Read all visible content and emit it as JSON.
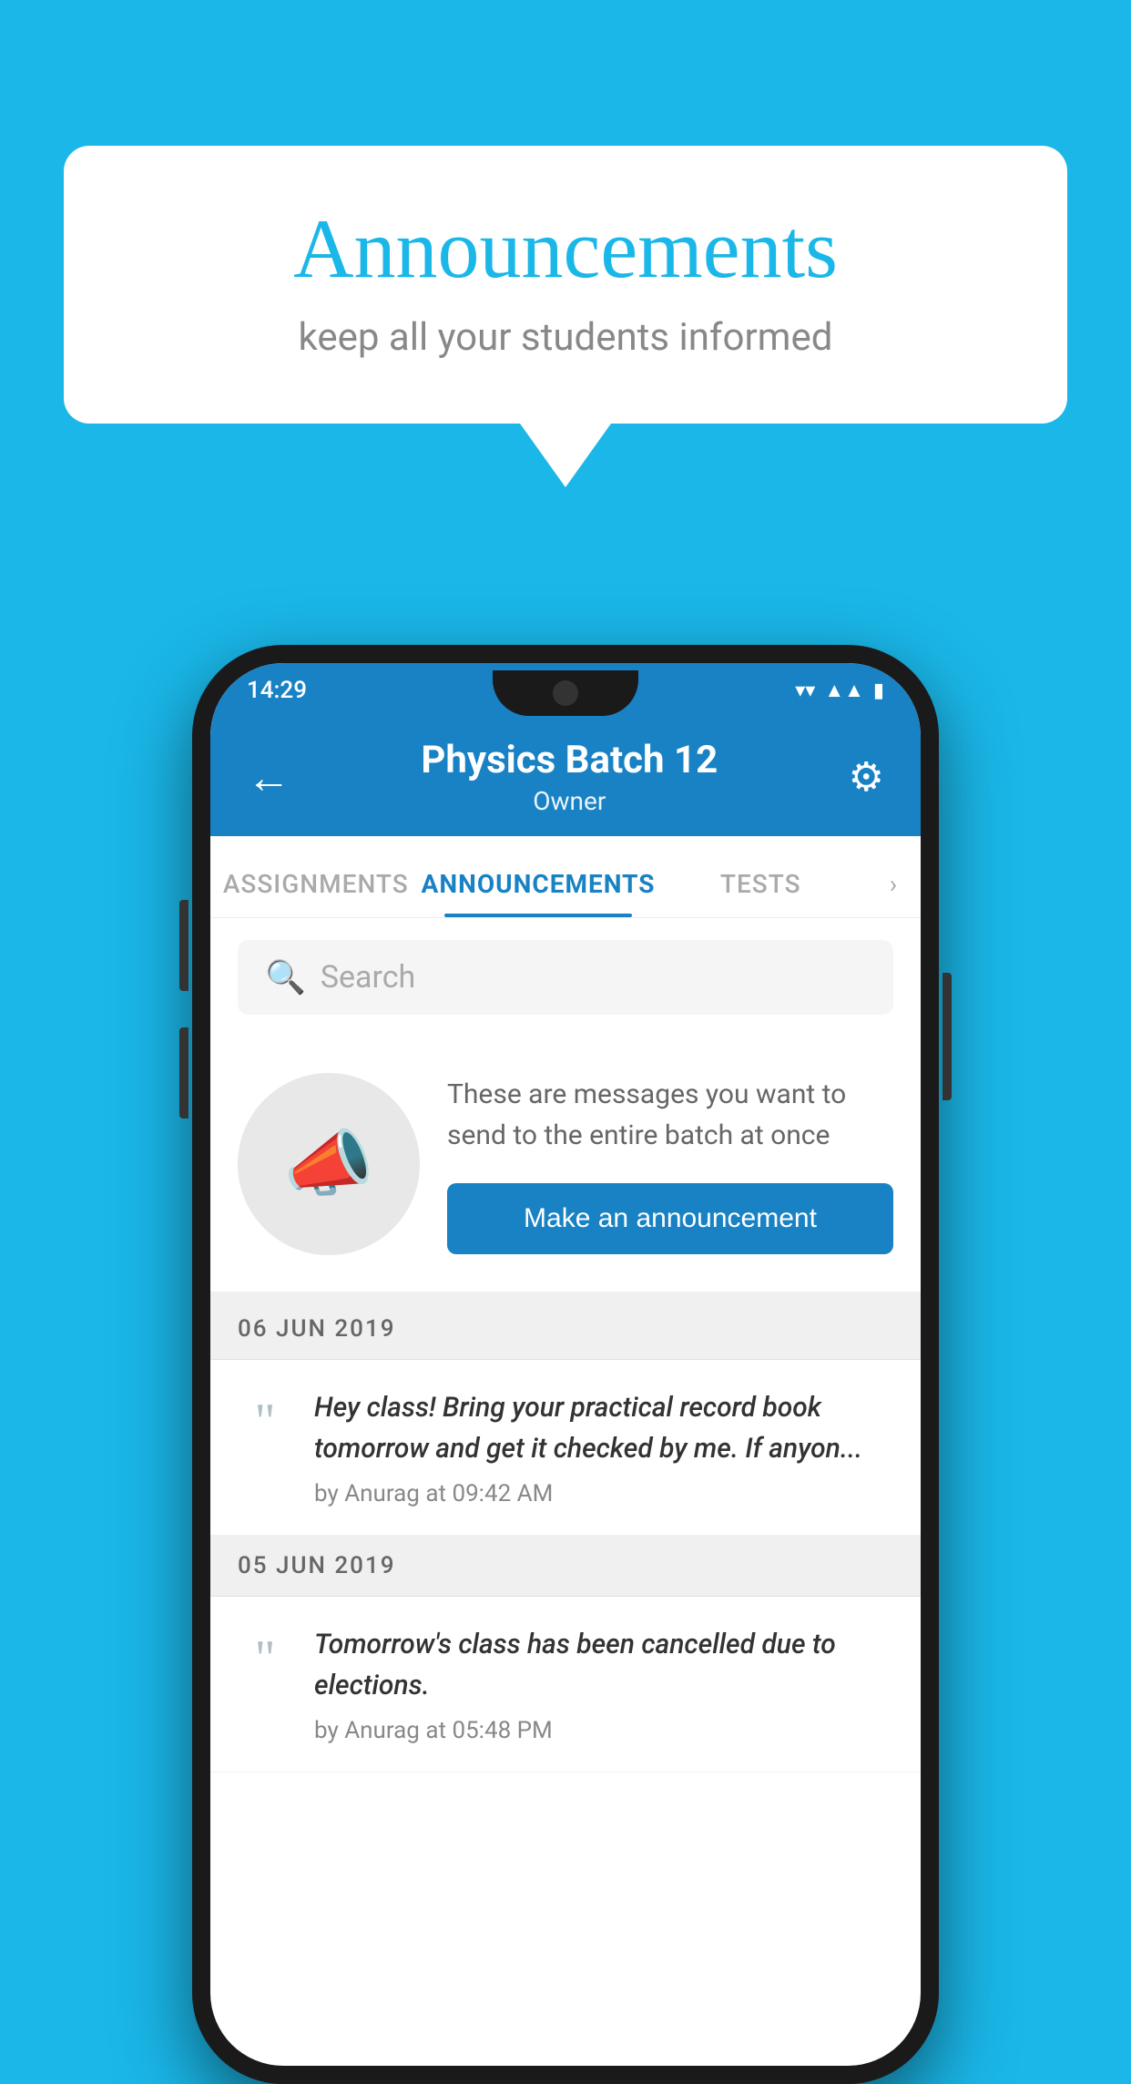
{
  "background_color": "#1ab7e8",
  "speech_bubble": {
    "title": "Announcements",
    "subtitle": "keep all your students informed"
  },
  "status_bar": {
    "time": "14:29",
    "wifi": "▼",
    "signal": "▲",
    "battery": "▮"
  },
  "app_bar": {
    "back_label": "←",
    "title": "Physics Batch 12",
    "subtitle": "Owner",
    "settings_label": "⚙"
  },
  "tabs": [
    {
      "label": "ASSIGNMENTS",
      "active": false
    },
    {
      "label": "ANNOUNCEMENTS",
      "active": true
    },
    {
      "label": "TESTS",
      "active": false
    }
  ],
  "search": {
    "placeholder": "Search"
  },
  "promo": {
    "description": "These are messages you want to send to the entire batch at once",
    "button_label": "Make an announcement"
  },
  "announcements": [
    {
      "date": "06  JUN  2019",
      "text": "Hey class! Bring your practical record book tomorrow and get it checked by me. If anyon...",
      "author": "by Anurag at 09:42 AM"
    },
    {
      "date": "05  JUN  2019",
      "text": "Tomorrow's class has been cancelled due to elections.",
      "author": "by Anurag at 05:48 PM"
    }
  ]
}
